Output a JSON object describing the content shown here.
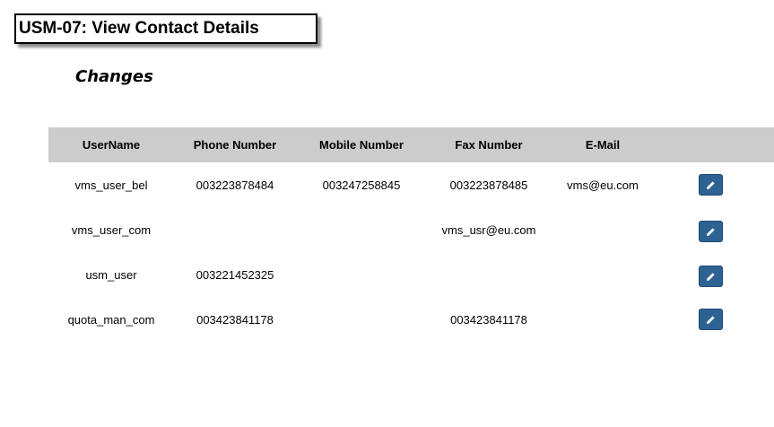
{
  "header": {
    "title": "USM-07: View Contact Details",
    "subtitle": "Changes"
  },
  "table": {
    "columns": [
      "UserName",
      "Phone Number",
      "Mobile Number",
      "Fax Number",
      "E-Mail"
    ],
    "rows": [
      {
        "username": "vms_user_bel",
        "phone": "003223878484",
        "mobile": "003247258845",
        "fax": "003223878485",
        "email": "vms@eu.com"
      },
      {
        "username": "vms_user_com",
        "phone": "",
        "mobile": "",
        "fax": "vms_usr@eu.com",
        "email": ""
      },
      {
        "username": "usm_user",
        "phone": "003221452325",
        "mobile": "",
        "fax": "",
        "email": ""
      },
      {
        "username": "quota_man_com",
        "phone": "003423841178",
        "mobile": "",
        "fax": "003423841178",
        "email": ""
      }
    ],
    "row_action_icon": "pencil-icon",
    "action_color": "#2e6293",
    "header_color": "#cccccc"
  }
}
